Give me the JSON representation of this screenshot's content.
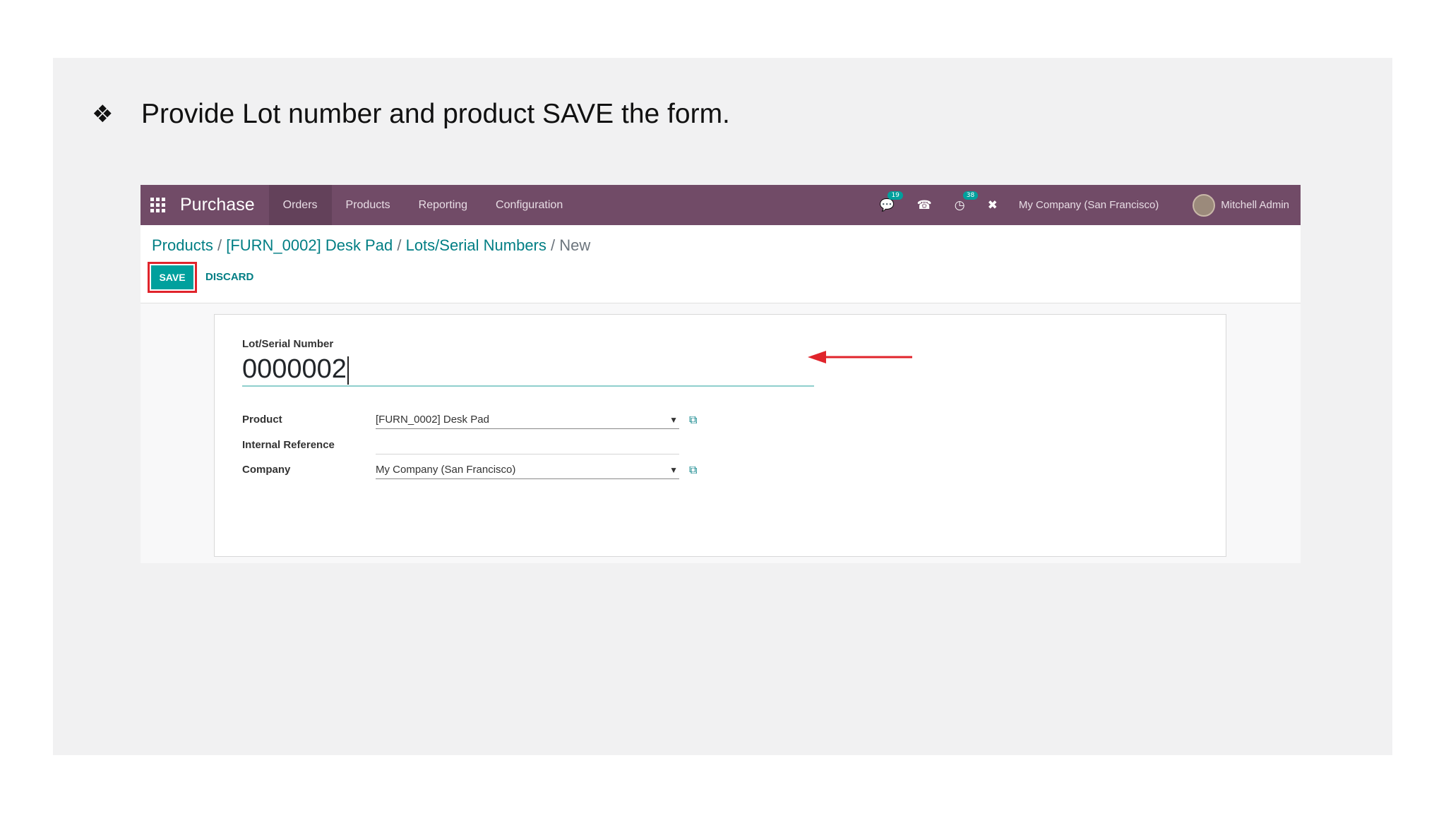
{
  "slide": {
    "bullet": "❖",
    "instruction": "Provide Lot number and product SAVE the form."
  },
  "navbar": {
    "app_title": "Purchase",
    "menu": [
      "Orders",
      "Products",
      "Reporting",
      "Configuration"
    ],
    "messages_badge": "19",
    "activities_badge": "38",
    "company": "My Company (San Francisco)",
    "user": "Mitchell Admin",
    "icons": [
      "apps-grid-icon",
      "chat-icon",
      "phone-icon",
      "clock-icon",
      "tools-icon"
    ]
  },
  "breadcrumb": {
    "items": [
      "Products",
      "[FURN_0002] Desk Pad",
      "Lots/Serial Numbers"
    ],
    "current": "New",
    "separator": "/"
  },
  "buttons": {
    "save": "SAVE",
    "discard": "DISCARD"
  },
  "form": {
    "lot_label": "Lot/Serial Number",
    "lot_value": "0000002",
    "product_label": "Product",
    "product_value": "[FURN_0002] Desk Pad",
    "internal_ref_label": "Internal Reference",
    "internal_ref_value": "",
    "company_label": "Company",
    "company_value": "My Company (San Francisco)"
  },
  "colors": {
    "navbar": "#714b67",
    "accent": "#00a09d",
    "link": "#017e84",
    "highlight": "#e0242b"
  }
}
